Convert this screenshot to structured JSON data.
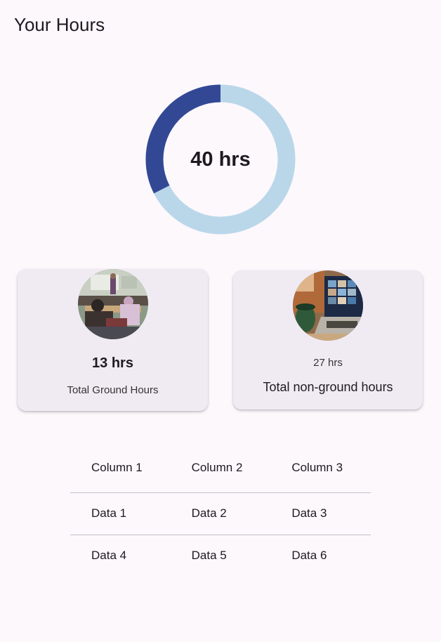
{
  "header": {
    "title": "Your Hours"
  },
  "summary": {
    "total_label": "40 hrs",
    "ground_fraction": 0.325,
    "colors": {
      "ground": "#334894",
      "non_ground": "#bad7ea"
    }
  },
  "cards": [
    {
      "value": "13 hrs",
      "caption": "Total Ground Hours",
      "image": "classroom-photo"
    },
    {
      "value": "27 hrs",
      "caption": "Total non-ground hours",
      "image": "laptop-video-call-photo"
    }
  ],
  "table": {
    "columns": [
      "Column 1",
      "Column 2",
      "Column 3"
    ],
    "rows": [
      [
        "Data 1",
        "Data 2",
        "Data 3"
      ],
      [
        "Data 4",
        "Data 5",
        "Data 6"
      ]
    ]
  }
}
